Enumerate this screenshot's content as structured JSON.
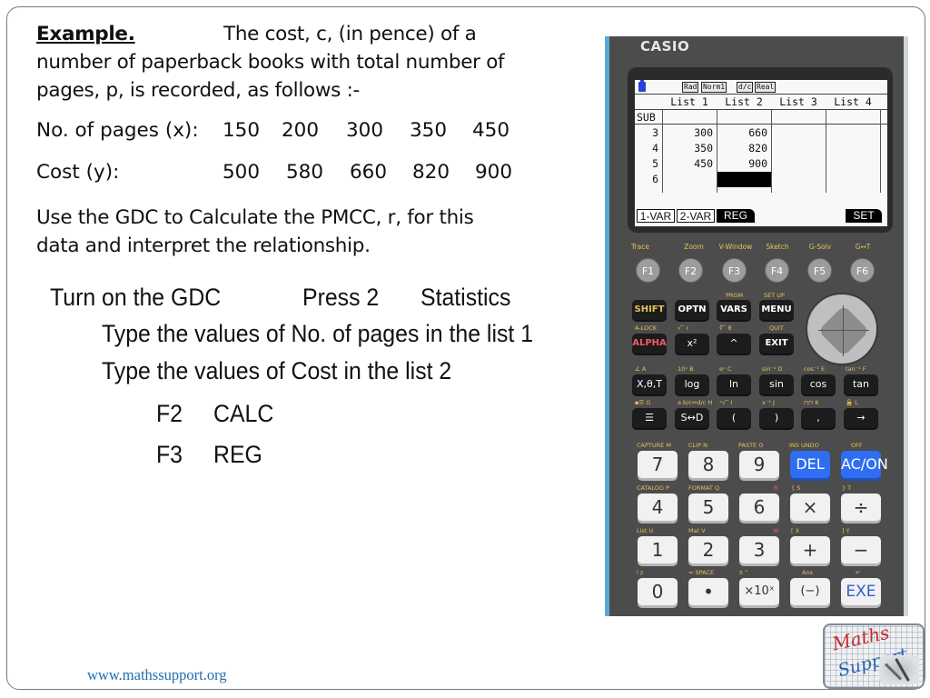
{
  "example": {
    "heading": "Example.",
    "intro_line1": "The cost, c, (in pence) of a",
    "intro_line2": "number of paperback books with total number of",
    "intro_line3": "pages, p, is recorded, as follows :-",
    "x_label": "No. of pages (x):",
    "x_values": [
      "150",
      "200",
      "300",
      "350",
      "450"
    ],
    "y_label": "Cost (y):",
    "y_values": [
      "500",
      "580",
      "660",
      "820",
      "900"
    ],
    "task_line1": "Use the GDC to Calculate the PMCC, r, for this",
    "task_line2": "data and interpret the relationship."
  },
  "steps": {
    "turn_on": "Turn on the GDC",
    "press": "Press 2",
    "statistics": "Statistics",
    "list1": "Type the values of No. of pages in the list 1",
    "list2": "Type the values of Cost in the list 2",
    "f2_key": "F2",
    "f2_action": "CALC",
    "f3_key": "F3",
    "f3_action": "REG"
  },
  "calculator": {
    "brand": "CASIO",
    "status_badges": [
      "Rad",
      "Norm1",
      "d/c",
      "Real"
    ],
    "list_headers": [
      "List 1",
      "List 2",
      "List 3",
      "List 4"
    ],
    "sub_label": "SUB",
    "rows": [
      {
        "index": "3",
        "list1": "300",
        "list2": "660"
      },
      {
        "index": "4",
        "list1": "350",
        "list2": "820"
      },
      {
        "index": "5",
        "list1": "450",
        "list2": "900"
      },
      {
        "index": "6",
        "list1": "",
        "list2": ""
      }
    ],
    "softkeys": [
      "1-VAR",
      "2-VAR",
      "REG",
      "SET"
    ],
    "f_labels": [
      "Trace",
      "Zoom",
      "V-Window",
      "Sketch",
      "G-Solv",
      "G↔T"
    ],
    "f_keys": [
      "F1",
      "F2",
      "F3",
      "F4",
      "F5",
      "F6"
    ],
    "row1_top": [
      "",
      "",
      "PRGM",
      "SET UP"
    ],
    "row1_keys": [
      "SHIFT",
      "OPTN",
      "VARS",
      "MENU"
    ],
    "row2_top": [
      "A-LOCK",
      "√‾   r",
      "∛‾   θ",
      "QUIT"
    ],
    "row2_keys": [
      "ALPHA",
      "x²",
      "^",
      "EXIT"
    ],
    "row3_top": [
      "∠  A",
      "10ˣ  B",
      "eˣ  C",
      "sin⁻¹ D",
      "cos⁻¹ E",
      "tan⁻¹ F"
    ],
    "row3_keys": [
      "X,θ,T",
      "log",
      "ln",
      "sin",
      "cos",
      "tan"
    ],
    "row4_top": [
      "▪☰  G",
      "a b/c↔d/c H",
      "ˣ√‾  I",
      "x⁻¹  J",
      "⊓⊓  K",
      "🔓  L"
    ],
    "row4_keys": [
      "☰",
      "S↔D",
      "(",
      ")",
      ",",
      "→"
    ],
    "row5_top": [
      "CAPTURE M",
      "CLIP  N",
      "PASTE  O",
      "INS  UNDO",
      "OFF"
    ],
    "row5_keys": [
      "7",
      "8",
      "9",
      "DEL",
      "AC/ON"
    ],
    "row6_top": [
      "CATALOG P",
      "FORMAT Q",
      "R",
      "{   S",
      "}   T"
    ],
    "row6_keys": [
      "4",
      "5",
      "6",
      "×",
      "÷"
    ],
    "row7_top": [
      "List  U",
      "Mat  V",
      "W",
      "[   X",
      "]   Y"
    ],
    "row7_keys": [
      "1",
      "2",
      "3",
      "+",
      "−"
    ],
    "row8_top": [
      "i    z",
      "=  SPACE",
      "π   ”",
      "Ans",
      "↵"
    ],
    "row8_keys": [
      "0",
      "•",
      "×10ˣ",
      "(−)",
      "EXE"
    ]
  },
  "footer": {
    "website": "www.mathssupport.org",
    "logo_line1": "Maths",
    "logo_line2": "Support"
  }
}
